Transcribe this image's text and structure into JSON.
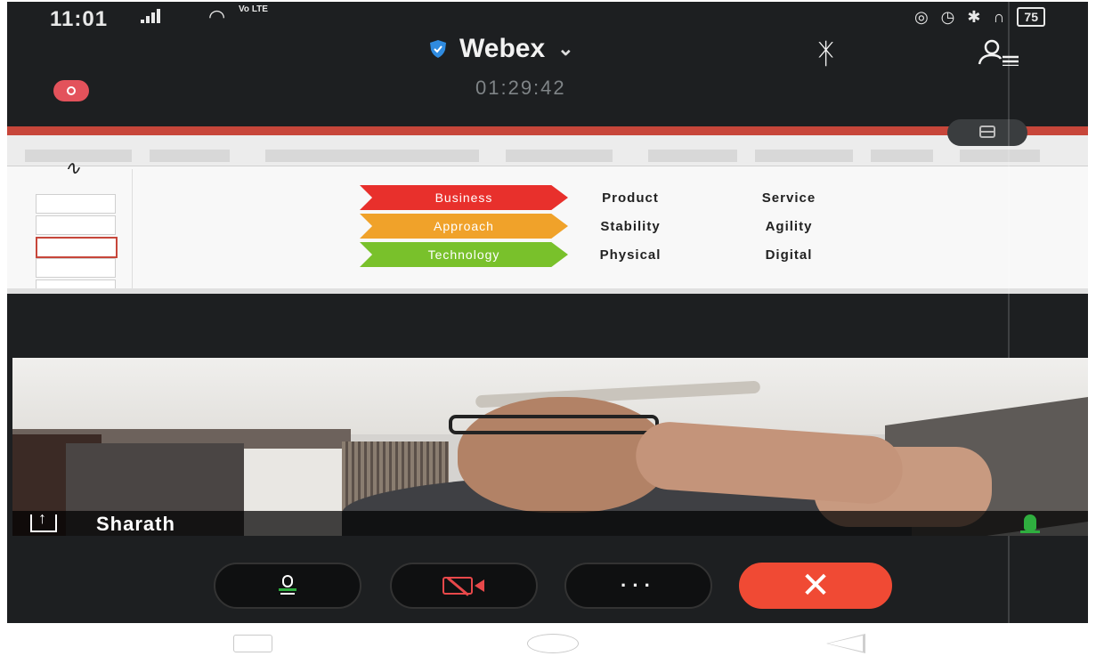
{
  "status_bar": {
    "time": "11:01",
    "network": "Vo LTE",
    "battery": "75"
  },
  "meeting": {
    "app_title": "Webex",
    "timer": "01:29:42"
  },
  "shared_screen": {
    "rows": [
      {
        "label": "Business",
        "col1": "Product",
        "col2": "Service",
        "color": "#e8302c"
      },
      {
        "label": "Approach",
        "col1": "Stability",
        "col2": "Agility",
        "color": "#f0a22a"
      },
      {
        "label": "Technology",
        "col1": "Physical",
        "col2": "Digital",
        "color": "#79c12b"
      }
    ]
  },
  "video_tile": {
    "participant_name": "Sharath"
  },
  "controls": {
    "more_label": "···"
  },
  "colors": {
    "end_call": "#f04a34",
    "mute_accent": "#2fae3f",
    "video_off": "#e8484a",
    "record_dot": "#e3525b"
  }
}
